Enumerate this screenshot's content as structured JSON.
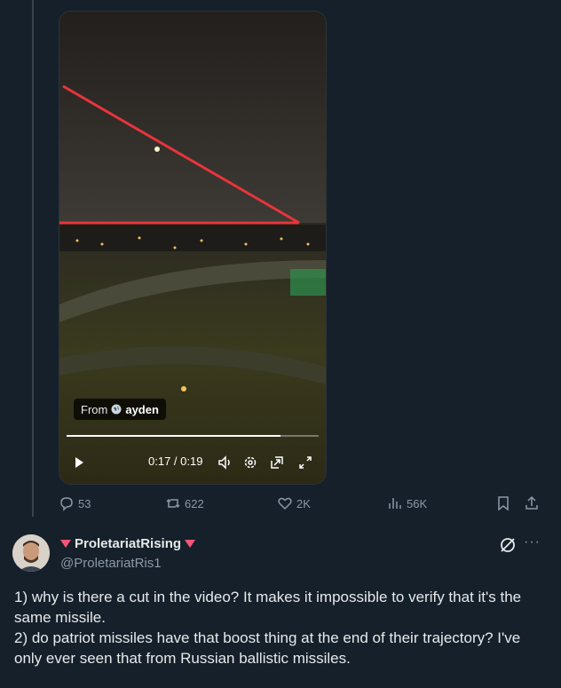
{
  "video": {
    "from_prefix": "From",
    "from_name": "ayden",
    "time_current": "0:17",
    "time_separator": " / ",
    "time_total": "0:19",
    "progress_fraction": 0.85,
    "icons": [
      "play-icon",
      "volume-icon",
      "settings-icon",
      "pip-icon",
      "fullscreen-icon"
    ]
  },
  "actions": {
    "replies": "53",
    "reposts": "622",
    "likes": "2K",
    "views": "56K"
  },
  "reply": {
    "display_name": "ProletariatRising",
    "handle": "@ProletariatRis1",
    "text_lines": [
      "1) why is there a cut in the video? It makes it impossible to verify that it's the same missile.",
      "2) do patriot missiles have that boost thing at the end of their trajectory? I've only ever seen that from Russian ballistic missiles."
    ],
    "more_label": "···"
  },
  "colors": {
    "background": "#15202b",
    "muted": "#8b98a5",
    "annotation_red": "#e8343c",
    "name_triangle": "#f4557a"
  }
}
